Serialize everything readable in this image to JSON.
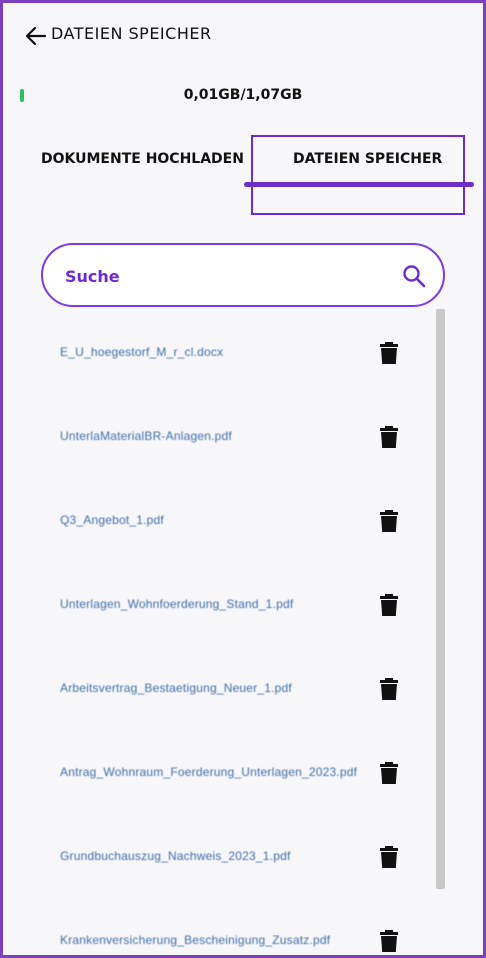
{
  "header": {
    "title": "DATEIEN SPEICHER"
  },
  "storage": {
    "usage": "0,01GB/1,07GB",
    "status_color": "#22c55e"
  },
  "tabs": [
    {
      "label": "DOKUMENTE HOCHLADEN"
    },
    {
      "label": "DATEIEN SPEICHER",
      "active": true
    }
  ],
  "search": {
    "placeholder": "Suche",
    "value": ""
  },
  "files": [
    {
      "name": "E_U_hoegestorf_M_r_cl.docx"
    },
    {
      "name": "UnterlaMaterialBR-Anlagen.pdf"
    },
    {
      "name": "Q3_Angebot_1.pdf"
    },
    {
      "name": "Unterlagen_Wohnfoerderung_Stand_1.pdf"
    },
    {
      "name": "Arbeitsvertrag_Bestaetigung_Neuer_1.pdf"
    },
    {
      "name": "Antrag_Wohnraum_Foerderung_Unterlagen_2023.pdf"
    },
    {
      "name": "Grundbuchauszug_Nachweis_2023_1.pdf"
    },
    {
      "name": "Krankenversicherung_Bescheinigung_Zusatz.pdf"
    }
  ],
  "colors": {
    "accent": "#7c3aed",
    "frame": "#7b3fbf",
    "link": "#3f6fa8"
  },
  "icons": {
    "back": "arrow-left-icon",
    "search": "magnifier-icon",
    "delete": "trash-icon"
  }
}
